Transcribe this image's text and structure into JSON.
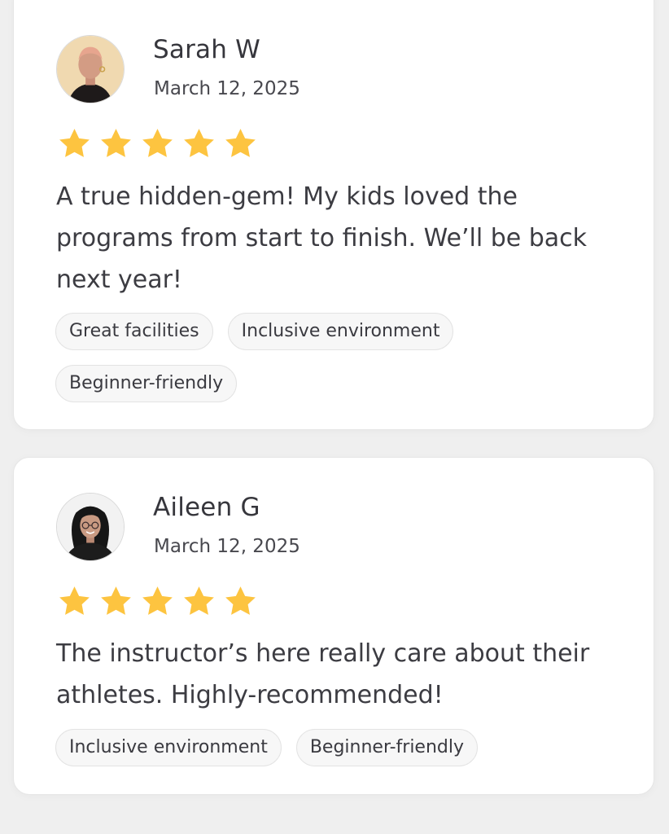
{
  "colors": {
    "star": "#FDC440",
    "background": "#EFEFEF",
    "card": "#FFFFFF",
    "tag_background": "#F7F7F7"
  },
  "reviews": [
    {
      "name": "Sarah W",
      "date": "March 12, 2025",
      "rating": 5,
      "text": "A true hidden-gem! My kids loved the programs from start to finish. We’ll be back next year!",
      "tags": [
        "Great facilities",
        "Inclusive environment",
        "Beginner-friendly"
      ]
    },
    {
      "name": "Aileen G",
      "date": "March 12, 2025",
      "rating": 5,
      "text": "The instructor’s here really care about their athletes. Highly-recommended!",
      "tags": [
        "Inclusive environment",
        "Beginner-friendly"
      ]
    }
  ]
}
